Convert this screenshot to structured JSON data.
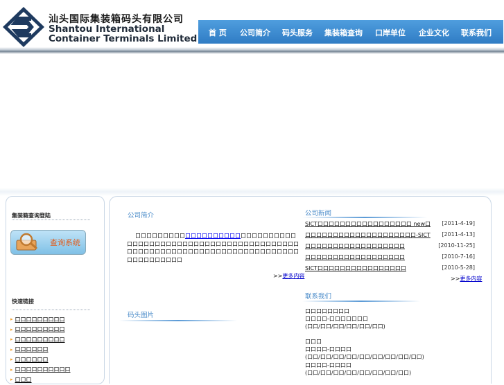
{
  "header": {
    "logo_cn": "汕头国际集装箱码头有限公司",
    "logo_en_line1": "Shantou International",
    "logo_en_line2": "Container Terminals Limited",
    "nav": [
      "首 页",
      "公司简介",
      "码头服务",
      "集装箱查询",
      "口岸单位",
      "企业文化",
      "联系我们"
    ]
  },
  "sidebar": {
    "login_title": "集装箱查询登陆",
    "query_button_label": "查询系统",
    "quick_links_title": "快速链接",
    "quick_links": [
      "口口口口口口口口口",
      "口口口口口口口口口",
      "口口口口口口口口口",
      "口口口口口口",
      "口口口口口口",
      "口口口口口口口口口口",
      "口口口"
    ]
  },
  "intro": {
    "title": "公司简介",
    "text_before_link": "口口口口口口口口口",
    "link_text": "口口口口口口口口口口",
    "text_after_link": "口口口口口口口口口口口口口口口口口口口口口口口口口口口口口口口口口口口口口口口口口口口口口口口口口口口口口口口口口口口口口口口口口口口口口口口口口口口口口口口口口口",
    "more_prefix": ">>",
    "more_link": "更多内容"
  },
  "lower_left": {
    "title": "码头图片"
  },
  "news": {
    "title": "公司新闻",
    "items": [
      {
        "title": "SICT口口口口口口口口口口口口口口口口口 new口",
        "date": "[2011-4-19]"
      },
      {
        "title": "口口口口口口口口口口口口口口口口口口口口-SICT",
        "date": "[2011-4-13]"
      },
      {
        "title": "口口口口口口口口口口口口口口口口口口",
        "date": "[2010-11-25]"
      },
      {
        "title": "口口口口口口口口口口口口口口口口口口",
        "date": "[2010-7-16]"
      },
      {
        "title": "SICT口口口口口口口口口口口口口口口口",
        "date": "[2010-5-28]"
      }
    ],
    "more_prefix": ">>",
    "more_link": "更多内容"
  },
  "contact": {
    "title": "联系我们",
    "lines": [
      "口口口口口口口口",
      "口口口口-口口口口口口口",
      "(口口/口口/口口/口口/口口/口口)",
      "",
      "口口口",
      "口口口口-口口口口",
      "(口口/口口/口口/口口/口口/口口/口口/口口/口口)",
      "口口口口-口口口口",
      "(口口/口口/口口/口口/口口/口口/口口/口口)"
    ]
  }
}
